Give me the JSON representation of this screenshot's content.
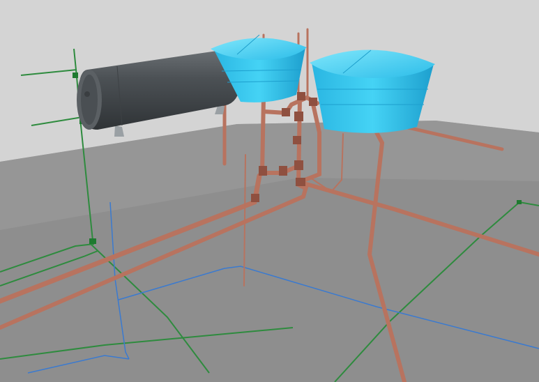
{
  "scene": {
    "colors": {
      "wall": "#d2d2d2",
      "floor": "#8c8c8c",
      "floor_far": "#9a9a9a",
      "copper_pipe": "#b8735f",
      "copper_pipe_dark": "#8f5040",
      "cold_water_line": "#2e8b3e",
      "blue_line": "#3a7ad0",
      "water_tank": "#35c8ee",
      "water_tank_dark": "#1fa3cf",
      "heater_tank": "#555a5e",
      "heater_tank_light": "#7a7f83"
    },
    "objects": [
      {
        "name": "water-heater-tank",
        "kind": "cylinder"
      },
      {
        "name": "water-tank-left",
        "kind": "reservoir"
      },
      {
        "name": "water-tank-right",
        "kind": "reservoir"
      },
      {
        "name": "copper-pipe-network",
        "kind": "pipes"
      },
      {
        "name": "green-cold-water-lines",
        "kind": "lines"
      },
      {
        "name": "blue-lines",
        "kind": "lines"
      }
    ]
  }
}
